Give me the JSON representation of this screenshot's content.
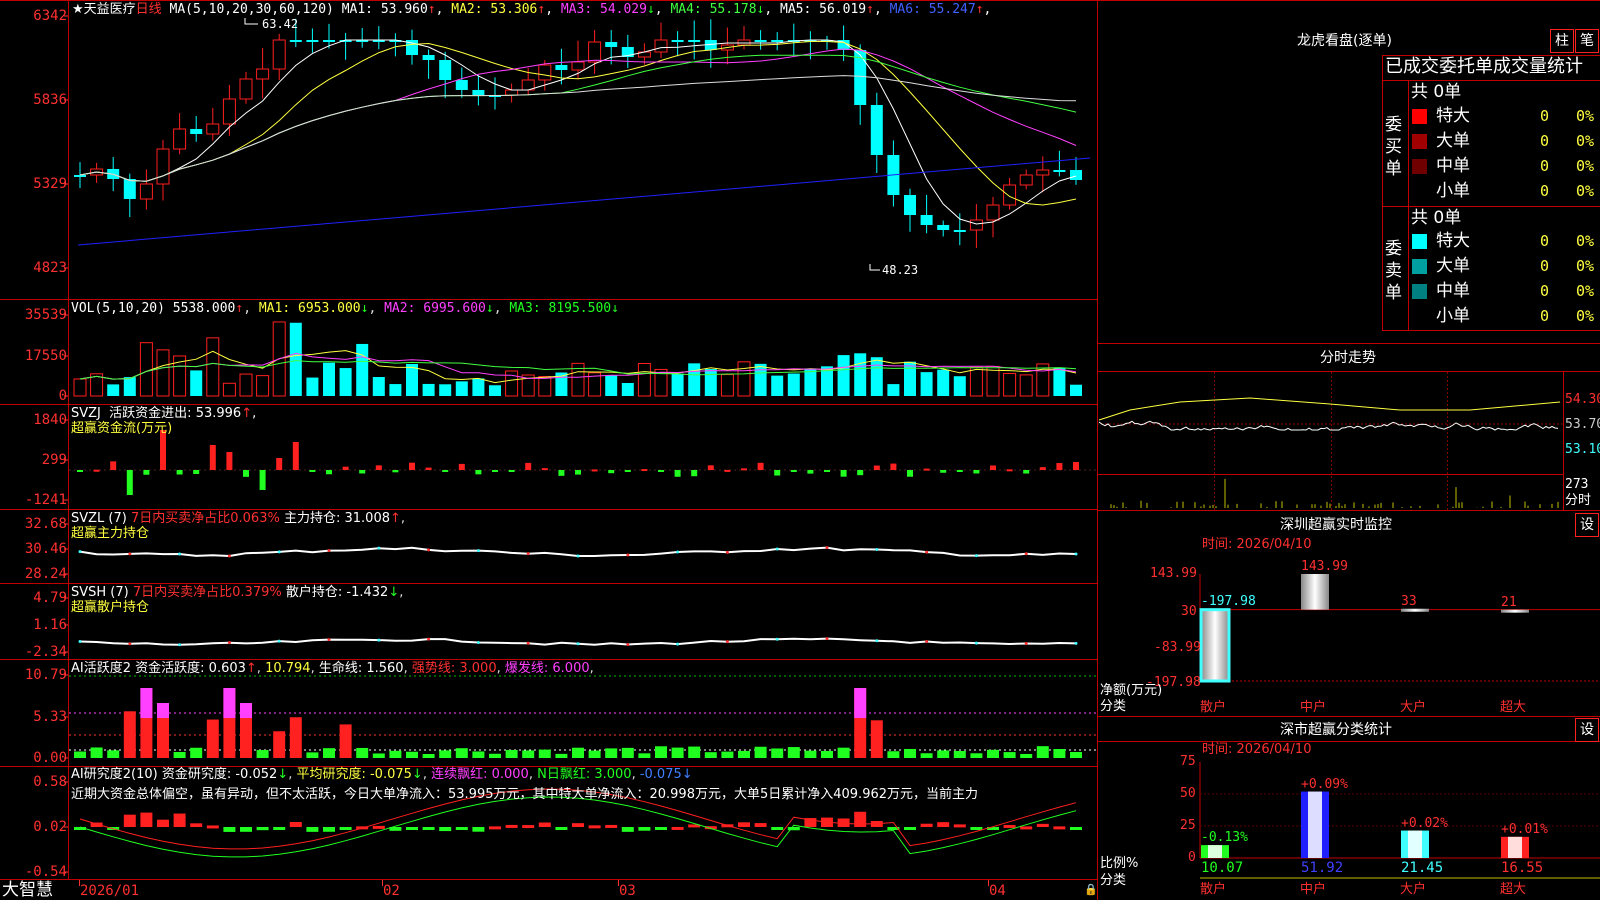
{
  "main_panel": {
    "symbol": "★天益医疗",
    "period": "日线",
    "ma_params": "MA(5,10,20,30,60,120)",
    "ma_values": [
      {
        "label": "MA1:",
        "value": "53.960",
        "arrow": "↑",
        "color": "#ffffff"
      },
      {
        "label": "MA2:",
        "value": "53.306",
        "arrow": "↑",
        "color": "#ffff40"
      },
      {
        "label": "MA3:",
        "value": "54.029",
        "arrow": "↓",
        "color": "#ff40ff"
      },
      {
        "label": "MA4:",
        "value": "55.178",
        "arrow": "↓",
        "color": "#40ff40"
      },
      {
        "label": "MA5:",
        "value": "56.019",
        "arrow": "↑",
        "color": "#ffffff"
      },
      {
        "label": "MA6:",
        "value": "55.247",
        "arrow": "↑",
        "color": "#4060ff"
      }
    ],
    "y_ticks": [
      "6342",
      "5836",
      "5329",
      "4823"
    ],
    "high_label": "63.42",
    "low_label": "48.23"
  },
  "vol_panel": {
    "params": "VOL(5,10,20)",
    "value": "5538.000",
    "ma": [
      {
        "label": "MA1:",
        "value": "6953.000",
        "arrow": "↓"
      },
      {
        "label": "MA2:",
        "value": "6995.600",
        "arrow": "↓"
      },
      {
        "label": "MA3:",
        "value": "8195.500",
        "arrow": "↓"
      }
    ],
    "y_ticks": [
      "35539",
      "17550",
      "0"
    ]
  },
  "svzj_panel": {
    "name": "SVZJ",
    "label": "活跃资金进出:",
    "value": "53.996",
    "subtitle": "超赢资金流(万元)",
    "y_ticks": [
      "1840",
      "299",
      "-1241"
    ]
  },
  "svzl_panel": {
    "name": "SVZL (7)",
    "ratio_text": "7日内买卖净占比0.063%",
    "hold_label": "主力持仓:",
    "hold_value": "31.008",
    "subtitle": "超赢主力持仓",
    "y_ticks": [
      "32.68",
      "30.46",
      "28.24"
    ]
  },
  "svsh_panel": {
    "name": "SVSH (7)",
    "ratio_text": "7日内买卖净占比0.379%",
    "hold_label": "散户持仓:",
    "hold_value": "-1.432",
    "subtitle": "超赢散户持仓",
    "y_ticks": [
      "4.79",
      "1.16",
      "-2.34"
    ]
  },
  "ai_active_panel": {
    "name": "AI活跃度2",
    "label": "资金活跃度:",
    "value": "0.603",
    "v2": "10.794",
    "life_label": "生命线:",
    "life_value": "1.560",
    "strong_label": "强势线:",
    "strong_value": "3.000",
    "burst_label": "爆发线:",
    "burst_value": "6.000",
    "y_ticks": [
      "10.79",
      "5.33",
      "0.00"
    ]
  },
  "ai_research_panel": {
    "name": "AI研究度2(10)",
    "label": "资金研究度:",
    "value": "-0.052",
    "avg_label": "平均研究度:",
    "avg_value": "-0.075",
    "red_label": "连续飘红:",
    "red_value": "0.000",
    "nred_label": "N日飘红:",
    "nred_value": "3.000",
    "last_value": "-0.075",
    "comment": "近期大资金总体偏空，虽有异动，但不太活跃，今日大单净流入：53.995万元，其中特大单净流入：20.998万元，大单5日累计净入409.962万元，当前主力",
    "y_ticks": [
      "0.58",
      "0.02",
      "-0.54"
    ]
  },
  "bottom_axis": {
    "brand": "大智慧",
    "dates": [
      "2026/01",
      "02",
      "03",
      "04"
    ]
  },
  "lhb": {
    "title": "龙虎看盘(逐单)",
    "btn1": "柱",
    "btn2": "笔",
    "tabs": "已成交委托单成交量统计",
    "buy_side": "委买单",
    "sell_side": "委卖单",
    "buy_total": "共 0单",
    "sell_total": "共 0单",
    "rows": [
      {
        "name": "特大",
        "count": "0",
        "pct": "0%"
      },
      {
        "name": "大单",
        "count": "0",
        "pct": "0%"
      },
      {
        "name": "中单",
        "count": "0",
        "pct": "0%"
      },
      {
        "name": "小单",
        "count": "0",
        "pct": "0%"
      }
    ],
    "buy_colors": [
      "#ff0000",
      "#a00000",
      "#700000",
      "#000000"
    ],
    "sell_colors": [
      "#00ffff",
      "#00a0a0",
      "#008080",
      "#000000"
    ]
  },
  "intraday": {
    "title": "分时走势",
    "prices": [
      "54.30",
      "53.70",
      "53.10"
    ],
    "vol": "273",
    "vol_unit": "分时"
  },
  "sz_monitor": {
    "title": "深圳超赢实时监控",
    "set": "设",
    "time_label": "时间:",
    "time": "2026/04/10",
    "y_ticks": [
      "143.99",
      "30",
      "-83.99",
      "-197.98"
    ],
    "y_label": "净额(万元)",
    "x_label": "分类",
    "categories": [
      "散户",
      "中户",
      "大户",
      "超大"
    ],
    "values": [
      -197.98,
      143.99,
      33,
      21
    ],
    "value_labels": [
      "-197.98",
      "143.99",
      "33",
      "21"
    ]
  },
  "sz_class": {
    "title": "深市超赢分类统计",
    "set": "设",
    "time_label": "时间:",
    "time": "2026/04/10",
    "y_ticks": [
      "75",
      "50",
      "25",
      "0"
    ],
    "y_label": "比例%",
    "x_label": "分类",
    "categories": [
      "散户",
      "中户",
      "大户",
      "超大"
    ],
    "values": [
      10.07,
      51.92,
      21.45,
      16.55
    ],
    "value_labels": [
      "10.07",
      "51.92",
      "21.45",
      "16.55"
    ],
    "delta_labels": [
      "-0.13%",
      "+0.09%",
      "+0.02%",
      "+0.01%"
    ]
  },
  "chart_data": [
    {
      "type": "bar",
      "title": "深圳超赢实时监控",
      "ylabel": "净额(万元)",
      "xlabel": "分类",
      "categories": [
        "散户",
        "中户",
        "大户",
        "超大"
      ],
      "values": [
        -197.98,
        143.99,
        33,
        21
      ],
      "ylim": [
        -197.98,
        143.99
      ]
    },
    {
      "type": "bar",
      "title": "深市超赢分类统计",
      "ylabel": "比例%",
      "xlabel": "分类",
      "categories": [
        "散户",
        "中户",
        "大户",
        "超大"
      ],
      "values": [
        10.07,
        51.92,
        21.45,
        16.55
      ],
      "ylim": [
        0,
        75
      ]
    }
  ]
}
